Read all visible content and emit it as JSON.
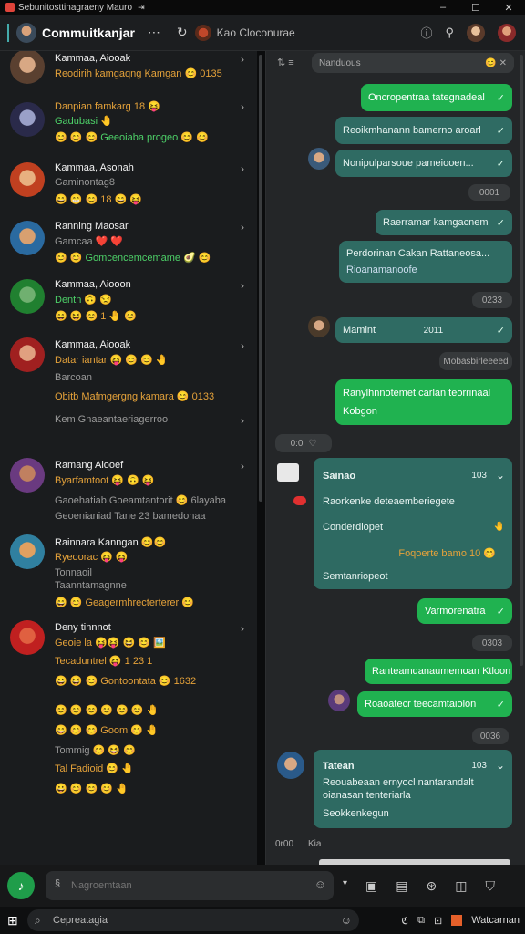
{
  "window": {
    "title": "Sebunitosttinagraeny Mauro",
    "controls": [
      "‒",
      "☐",
      "✕"
    ]
  },
  "header": {
    "app_title": "Commuitkanjar",
    "chat_name": "Kao Cloconurae",
    "icons": [
      "more-icon",
      "refresh-icon",
      "info-icon",
      "pin-icon"
    ]
  },
  "conversations": [
    {
      "name": "Kammaa, Aiooak",
      "line2": "Reodirih kamgaqng Kamgan 😊 0135"
    },
    {
      "name": "Danpian famkarg 18 😝",
      "line2": "Gadubasi 🤚",
      "line3": "😊 😊 😊 Geeoiaba progeo 😊 😊"
    },
    {
      "name": "Kammaa, Asonah",
      "line2": "Gaminontag8",
      "line3": "😄 😁 😊 18 😄 😝"
    },
    {
      "name": "Ranning Maosar",
      "line2": "Gamcaa ❤️ ❤️",
      "line3": "😊 😊 Gomcencemcemame 🥑 😊"
    },
    {
      "name": "Kammaa, Aiooon",
      "line2": "Dentn 🙃 😒",
      "line3": "😄 😆 😊 1 🤚 😊"
    },
    {
      "name": "Kammaa, Aiooak",
      "line2": "Datar iantar 😝 😊 😊 🤚",
      "line3": "Barcoan",
      "line4": "Obitb Mafmgergng kamara 😊 0133",
      "line5": "Kem Gnaeantaeriagerroo"
    },
    {
      "name": "Ramang Aiooef",
      "line2": "Byarfamtoot 😝 🙃 😝",
      "line3": "Gaoehatiab Goeamtantorit 😊 6layaba",
      "line4": "Geoenianiad Tane 23 bamedonaa"
    },
    {
      "name": "Rainnara Kanngan 😊😊",
      "line2": "Ryeoorac 😝 😝",
      "line3": "Tonnaoil",
      "line4": "Taanntamagnne",
      "line5": "😄 😊 Geagermhrecterterer 😊"
    },
    {
      "name": "Deny tinnnot",
      "line2": "Geoie la 😝😝 😆 😊 🖼️",
      "line3": "Tecaduntrel 😝 1 23 1",
      "line4": "😀 😆 😊 Gontoontata 😊 1632",
      "line5": "😊 😊 😊 😊 😊 😊 🤚",
      "line6": "😄 😊 😊 Goom 😊 🤚",
      "line7": "Tommig 😊 😆 😊",
      "line8": "Tal Fadioid 😊 🤚",
      "line9": "😀 😊 😊 😊 🤚"
    }
  ],
  "messages": {
    "search_chip": "Nanduous",
    "m1": "Oncropentraa tategnadeal",
    "m2": "Reoikmhanann bamerno aroarl",
    "m3": "Nonipulparsoue pameiooen...",
    "t1": "0001",
    "m4": "Raerramar kamgacnem",
    "m5": "Perdorinan Cakan Rattaneosa...",
    "m5b": "Rioanamanoofe",
    "t2": "0233",
    "m6": "Mamint",
    "m6_time": "2011",
    "sys1": "Mobasbirleeeed",
    "m7": "Ranylhnnotemet carlan teorrinaal",
    "m7b": "Kobgon",
    "reaction_time": "0:0",
    "card1": {
      "title": "Sainao",
      "time": "103",
      "r1": "Raorkenke deteaemberiegete",
      "r2": "Conderdiopet",
      "r3": "Foqoerte bamo 10 😊",
      "r4": "Semtanriopeot"
    },
    "m8": "Varmorenatra",
    "t3": "0303",
    "m9": "Ranteamdanaumemoan Ktloon",
    "m10": "Roaoatecr teecamtaiolon",
    "t4": "0036",
    "card2": {
      "title": "Tatean",
      "time": "103",
      "r1": "Reouabeaan ernyocl nantarandalt",
      "r2": "oianasan tenteriarla",
      "r3": "Seokkenkegun"
    },
    "bottom_time": "0r00",
    "bottom_x": "Kia"
  },
  "composer": {
    "placeholder": "Nagroemtaan"
  },
  "taskbar": {
    "search_placeholder": "Cepreatagia",
    "app_label": "Watcarnan"
  }
}
